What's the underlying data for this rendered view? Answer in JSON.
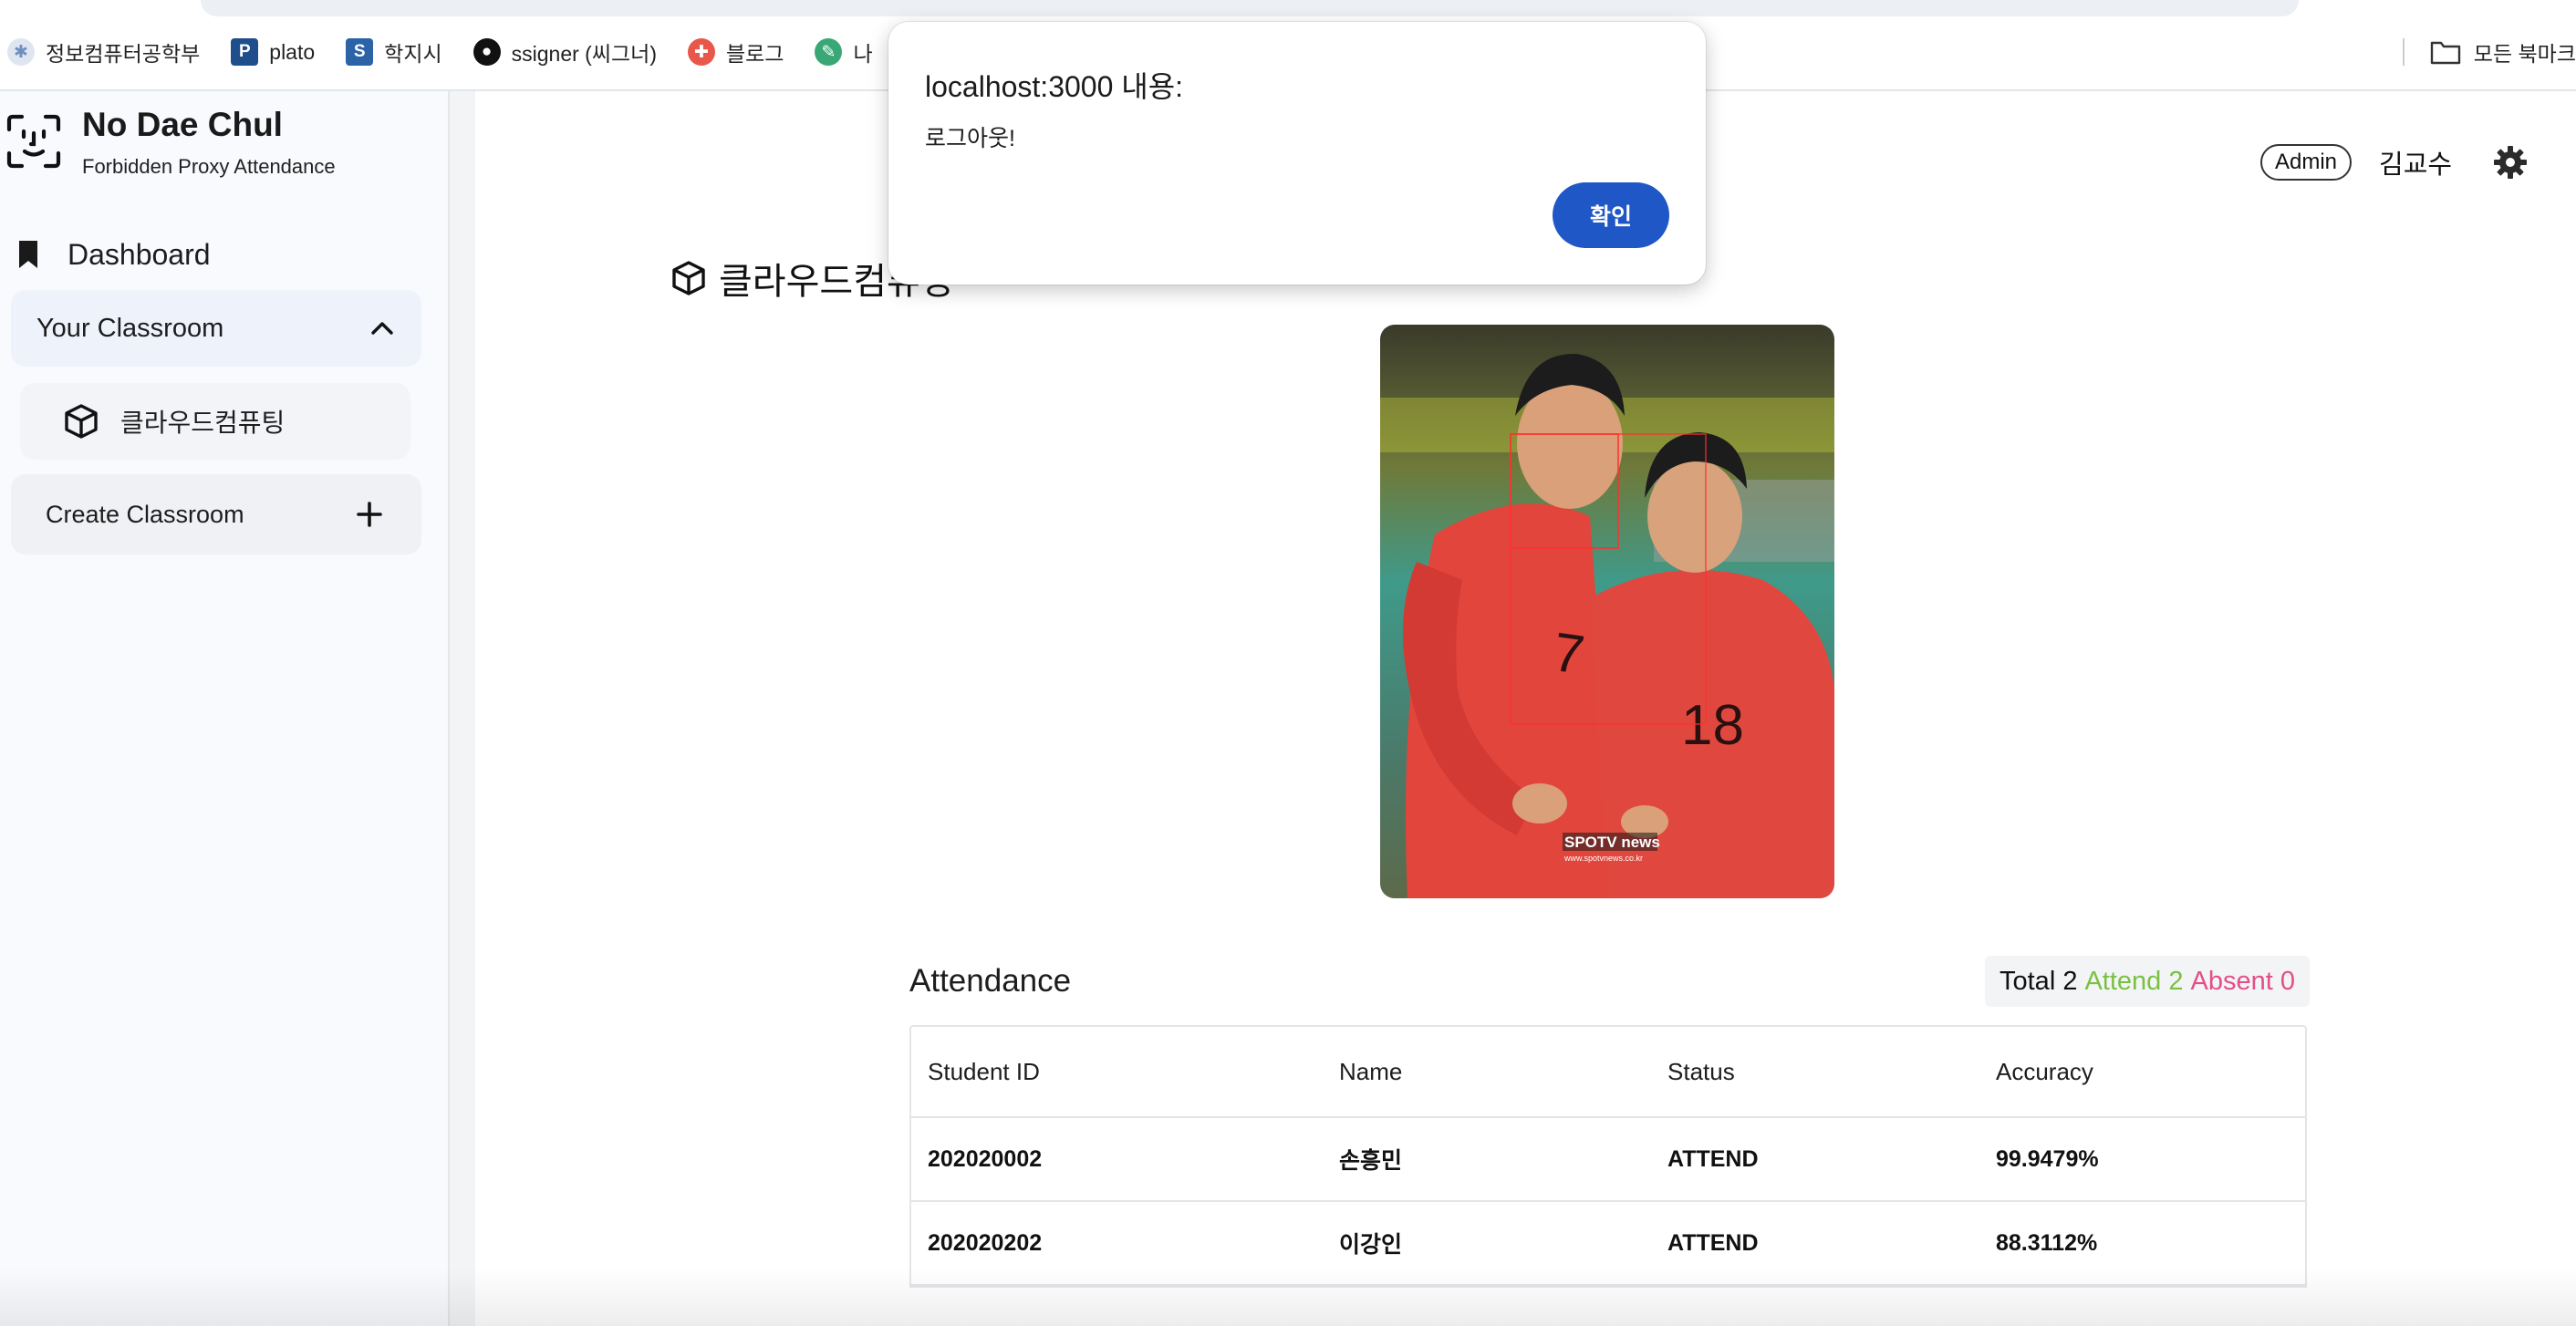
{
  "browser": {
    "bookmarks": [
      {
        "label": "정보컴퓨터공학부",
        "icon": "university-icon",
        "color": "#6f8fbf"
      },
      {
        "label": "plato",
        "icon": "plato-icon",
        "color": "#1f4e8c"
      },
      {
        "label": "학지시",
        "icon": "hakjisi-icon",
        "color": "#2c63a8"
      },
      {
        "label": "ssigner (씨그너)",
        "icon": "github-icon",
        "color": "#111111"
      },
      {
        "label": "블로그",
        "icon": "blog-icon",
        "color": "#e8584a"
      },
      {
        "label": "나",
        "icon": "bookmark-green-icon",
        "color": "#3aa876"
      }
    ],
    "all_bookmarks_label": "모든 북마크"
  },
  "sidebar": {
    "brand_name": "No Dae Chul",
    "brand_subtitle": "Forbidden Proxy Attendance",
    "dashboard_label": "Dashboard",
    "classroom_section_label": "Your Classroom",
    "classrooms": [
      {
        "label": "클라우드컴퓨팅"
      }
    ],
    "create_classroom_label": "Create Classroom"
  },
  "header": {
    "role": "Admin",
    "user_name": "김교수"
  },
  "main": {
    "title": "클라우드컴퓨팅",
    "photo_alt": "class photo with detected faces",
    "photo_watermark": "SPOTV news",
    "photo_watermark_sub": "www.spotvnews.co.kr",
    "jersey_numbers": [
      "7",
      "18"
    ],
    "attendance": {
      "title": "Attendance",
      "total_label": "Total 2",
      "attend_label": "Attend 2",
      "absent_label": "Absent 0",
      "colors": {
        "attend": "#7ac142",
        "absent": "#e34f86"
      },
      "columns": [
        "Student ID",
        "Name",
        "Status",
        "Accuracy"
      ],
      "rows": [
        {
          "id": "202020002",
          "name": "손흥민",
          "status": "ATTEND",
          "accuracy": "99.9479%"
        },
        {
          "id": "202020202",
          "name": "이강인",
          "status": "ATTEND",
          "accuracy": "88.3112%"
        }
      ]
    }
  },
  "dialog": {
    "title": "localhost:3000 내용:",
    "message": "로그아웃!",
    "ok_label": "확인",
    "accent": "#1f57c7"
  }
}
